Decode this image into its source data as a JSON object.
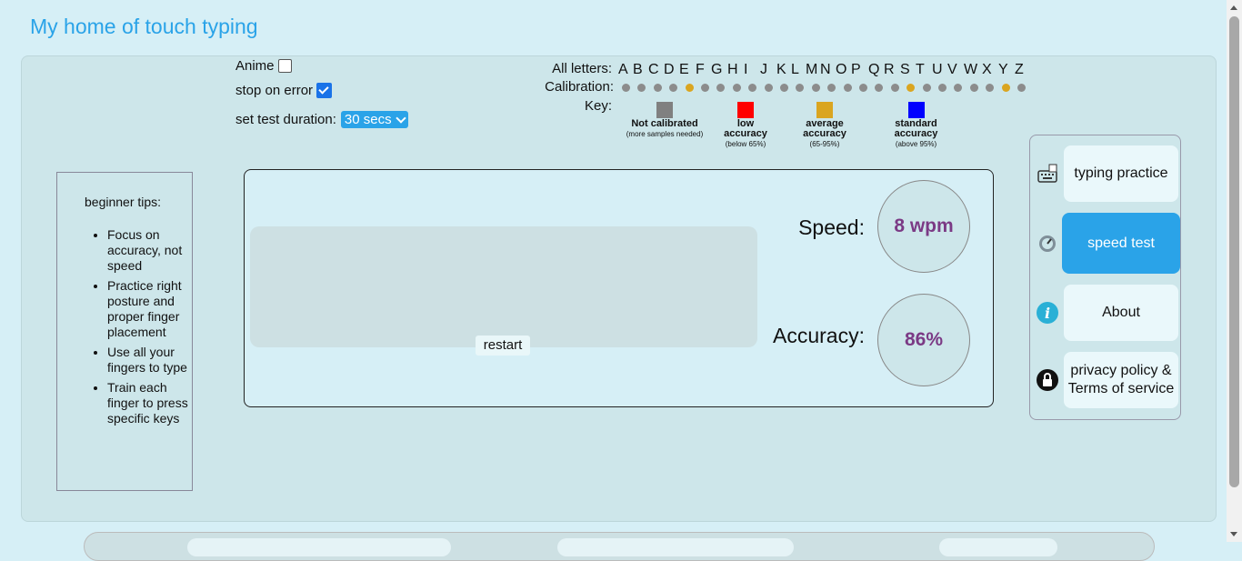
{
  "site": {
    "title": "My home of touch typing"
  },
  "options": {
    "anime_label": "Anime",
    "anime_checked": false,
    "stop_on_error_label": "stop on error",
    "stop_on_error_checked": true,
    "duration_label": "set test duration:",
    "duration_value": "30 secs"
  },
  "calibration": {
    "all_letters_label": "All letters:",
    "calibration_label": "Calibration:",
    "key_label": "Key:",
    "letters": [
      "A",
      "B",
      "C",
      "D",
      "E",
      "F",
      "G",
      "H",
      "I",
      "J",
      "K",
      "L",
      "M",
      "N",
      "O",
      "P",
      "Q",
      "R",
      "S",
      "T",
      "U",
      "V",
      "W",
      "X",
      "Y",
      "Z"
    ],
    "dot_colors": [
      "#8c8c8c",
      "#8c8c8c",
      "#8c8c8c",
      "#8c8c8c",
      "#daa520",
      "#8c8c8c",
      "#8c8c8c",
      "#8c8c8c",
      "#8c8c8c",
      "#8c8c8c",
      "#8c8c8c",
      "#8c8c8c",
      "#8c8c8c",
      "#8c8c8c",
      "#8c8c8c",
      "#8c8c8c",
      "#8c8c8c",
      "#8c8c8c",
      "#daa520",
      "#8c8c8c",
      "#8c8c8c",
      "#8c8c8c",
      "#8c8c8c",
      "#8c8c8c",
      "#daa520",
      "#8c8c8c"
    ],
    "legend": [
      {
        "title": "Not calibrated",
        "sub": "(more samples needed)",
        "color": "#808080"
      },
      {
        "title": "low accuracy",
        "sub": "(below 65%)",
        "color": "#ff0000"
      },
      {
        "title": "average accuracy",
        "sub": "(65-95%)",
        "color": "#daa520"
      },
      {
        "title": "standard accuracy",
        "sub": "(above 95%)",
        "color": "#0000ff"
      }
    ]
  },
  "tips": {
    "title": "beginner tips:",
    "items": [
      "Focus on accuracy, not speed",
      "Practice right posture and proper finger placement",
      "Use all your fingers to type",
      "Train each finger to press specific keys"
    ]
  },
  "test": {
    "restart_label": "restart",
    "speed_label": "Speed:",
    "speed_value": "8 wpm",
    "accuracy_label": "Accuracy:",
    "accuracy_value": "86%"
  },
  "nav": {
    "items": [
      {
        "label": "typing practice",
        "icon": "keyboard-icon"
      },
      {
        "label": "speed test",
        "icon": "speedometer-icon",
        "active": true
      },
      {
        "label": "About",
        "icon": "info-icon"
      },
      {
        "label": "privacy policy & Terms of service",
        "icon": "lock-icon"
      }
    ]
  },
  "colors": {
    "accent": "#2aa3e8",
    "stat_value": "#7b3a85",
    "background": "#d6eff6"
  }
}
